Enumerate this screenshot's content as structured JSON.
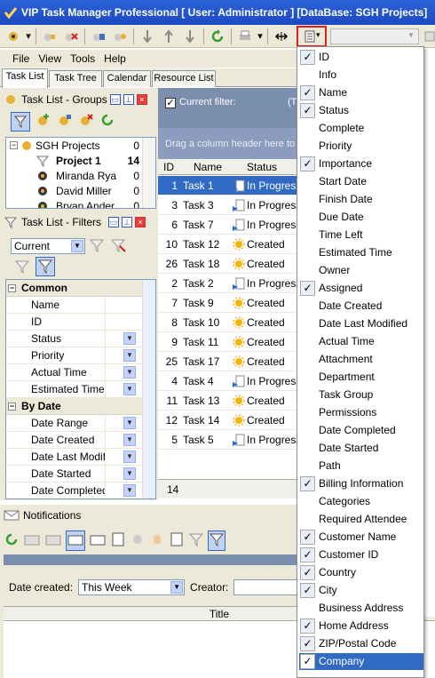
{
  "window": {
    "title": "VIP Task Manager Professional [ User: Administrator ] [DataBase: SGH Projects]"
  },
  "menu": [
    "File",
    "View",
    "Tools",
    "Help"
  ],
  "tabs": [
    "Task List",
    "Task Tree",
    "Calendar",
    "Resource List"
  ],
  "groups_pane": {
    "title": "Task List - Groups",
    "items": [
      {
        "label": "SGH Projects",
        "count": "0"
      },
      {
        "label": "Project 1",
        "count": "14"
      },
      {
        "label": "Miranda Rya",
        "count": "0"
      },
      {
        "label": "David Miller",
        "count": "0"
      },
      {
        "label": "Bryan Ander",
        "count": "0"
      }
    ]
  },
  "filters_pane": {
    "title": "Task List - Filters",
    "current": "Current",
    "categories": [
      {
        "name": "Common",
        "items": [
          "Name",
          "ID",
          "Status",
          "Priority",
          "Actual Time",
          "Estimated Time"
        ]
      },
      {
        "name": "By Date",
        "items": [
          "Date Range",
          "Date Created",
          "Date Last Modified",
          "Date Started",
          "Date Completed"
        ]
      }
    ]
  },
  "grid": {
    "current_filter_label": "Current filter:",
    "current_filter_suffix": "(T",
    "group_hint": "Drag a column header here to group",
    "headers": [
      "ID",
      "Name",
      "Status"
    ],
    "rows": [
      {
        "id": "1",
        "name": "Task 1",
        "status": "In Progress"
      },
      {
        "id": "3",
        "name": "Task 3",
        "status": "In Progress"
      },
      {
        "id": "6",
        "name": "Task 7",
        "status": "In Progress"
      },
      {
        "id": "10",
        "name": "Task 12",
        "status": "Created"
      },
      {
        "id": "26",
        "name": "Task 18",
        "status": "Created"
      },
      {
        "id": "2",
        "name": "Task 2",
        "status": "In Progress"
      },
      {
        "id": "7",
        "name": "Task 9",
        "status": "Created"
      },
      {
        "id": "8",
        "name": "Task 10",
        "status": "Created"
      },
      {
        "id": "9",
        "name": "Task 11",
        "status": "Created"
      },
      {
        "id": "25",
        "name": "Task 17",
        "status": "Created"
      },
      {
        "id": "4",
        "name": "Task 4",
        "status": "In Progress"
      },
      {
        "id": "11",
        "name": "Task 13",
        "status": "Created"
      },
      {
        "id": "12",
        "name": "Task 14",
        "status": "Created"
      },
      {
        "id": "5",
        "name": "Task 5",
        "status": "In Progress"
      }
    ],
    "footer_count": "14"
  },
  "notifications": {
    "title": "Notifications",
    "date_created_label": "Date created:",
    "date_created_value": "This Week",
    "creator_label": "Creator:",
    "column_title": "Title"
  },
  "column_menu": [
    {
      "label": "ID",
      "checked": true
    },
    {
      "label": "Info",
      "checked": false
    },
    {
      "label": "Name",
      "checked": true
    },
    {
      "label": "Status",
      "checked": true
    },
    {
      "label": "Complete",
      "checked": false
    },
    {
      "label": "Priority",
      "checked": false
    },
    {
      "label": "Importance",
      "checked": true
    },
    {
      "label": "Start Date",
      "checked": false
    },
    {
      "label": "Finish Date",
      "checked": false
    },
    {
      "label": "Due Date",
      "checked": false
    },
    {
      "label": "Time Left",
      "checked": false
    },
    {
      "label": "Estimated Time",
      "checked": false
    },
    {
      "label": "Owner",
      "checked": false
    },
    {
      "label": "Assigned",
      "checked": true
    },
    {
      "label": "Date Created",
      "checked": false
    },
    {
      "label": "Date Last Modified",
      "checked": false
    },
    {
      "label": "Actual Time",
      "checked": false
    },
    {
      "label": "Attachment",
      "checked": false
    },
    {
      "label": "Department",
      "checked": false
    },
    {
      "label": "Task Group",
      "checked": false
    },
    {
      "label": "Permissions",
      "checked": false
    },
    {
      "label": "Date Completed",
      "checked": false
    },
    {
      "label": "Date Started",
      "checked": false
    },
    {
      "label": "Path",
      "checked": false
    },
    {
      "label": "Billing Information",
      "checked": true
    },
    {
      "label": "Categories",
      "checked": false
    },
    {
      "label": "Required Attendee",
      "checked": false
    },
    {
      "label": "Customer Name",
      "checked": true
    },
    {
      "label": "Customer ID",
      "checked": true
    },
    {
      "label": "Country",
      "checked": true
    },
    {
      "label": "City",
      "checked": true
    },
    {
      "label": "Business Address",
      "checked": false
    },
    {
      "label": "Home Address",
      "checked": true
    },
    {
      "label": "ZIP/Postal Code",
      "checked": true
    },
    {
      "label": "Company",
      "checked": true
    }
  ],
  "colors": {
    "selection": "#316ac5",
    "titlebar": "#1c48c1",
    "highlight_box": "#e02020"
  }
}
